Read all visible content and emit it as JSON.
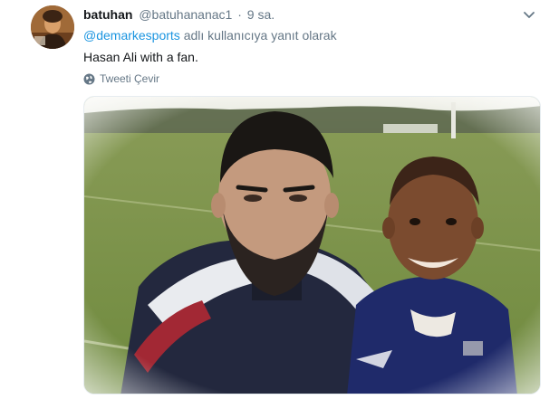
{
  "tweet": {
    "display_name": "batuhan",
    "handle": "@batuhananac1",
    "separator": "·",
    "time": "9 sa.",
    "reply_mention": "@demarkesports",
    "reply_suffix": "adlı kullanıcıya yanıt olarak",
    "text": "Hasan Ali with a fan.",
    "translate_label": "Tweeti Çevir",
    "menu_icon": "chevron-down-icon"
  },
  "colors": {
    "link": "#1b95e0",
    "secondary_text": "#657786",
    "primary_text": "#14171a"
  }
}
